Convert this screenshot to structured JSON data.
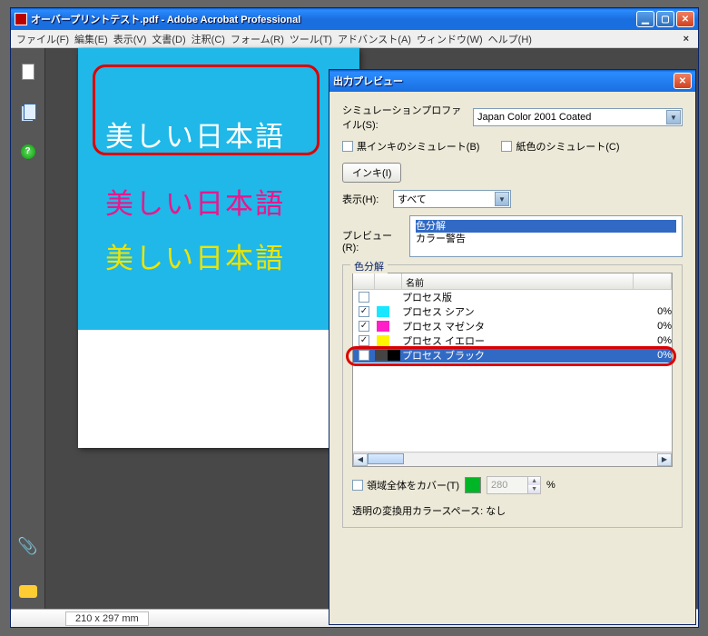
{
  "window": {
    "title": "オーバープリントテスト.pdf - Adobe Acrobat Professional",
    "menus": [
      "ファイル(F)",
      "編集(E)",
      "表示(V)",
      "文書(D)",
      "注釈(C)",
      "フォーム(R)",
      "ツール(T)",
      "アドバンスト(A)",
      "ウィンドウ(W)",
      "ヘルプ(H)"
    ],
    "status_dim": "210 x 297 mm"
  },
  "document": {
    "text1": "美しい日本語",
    "text2": "美しい日本語",
    "text3": "美しい日本語"
  },
  "dialog": {
    "title": "出力プレビュー",
    "sim_profile_label": "シミュレーションプロファイル(S):",
    "sim_profile_value": "Japan Color 2001 Coated",
    "sim_black_ink": "黒インキのシミュレート(B)",
    "sim_paper": "紙色のシミュレート(C)",
    "ink_btn": "インキ(I)",
    "display_label": "表示(H):",
    "display_value": "すべて",
    "preview_label": "プレビュー(R):",
    "preview_opt1": "色分解",
    "preview_opt2": "カラー警告",
    "fieldset_legend": "色分解",
    "col_name": "名前",
    "rows": [
      {
        "checked": false,
        "swatch": "#ffffff",
        "name": "プロセス版",
        "pct": ""
      },
      {
        "checked": true,
        "swatch": "#18e7ff",
        "name": "プロセス シアン",
        "pct": "0%"
      },
      {
        "checked": true,
        "swatch": "#ff1ec8",
        "name": "プロセス マゼンタ",
        "pct": "0%"
      },
      {
        "checked": true,
        "swatch": "#fff500",
        "name": "プロセス イエロー",
        "pct": "0%"
      },
      {
        "checked": false,
        "swatch_half": [
          "#444",
          "#000"
        ],
        "name": "プロセス ブラック",
        "pct": "0%",
        "selected": true
      }
    ],
    "cover_label": "領域全体をカバー(T)",
    "cover_value": "280",
    "cover_unit": "%",
    "footer_label": "透明の変換用カラースペース:",
    "footer_value": "なし"
  }
}
